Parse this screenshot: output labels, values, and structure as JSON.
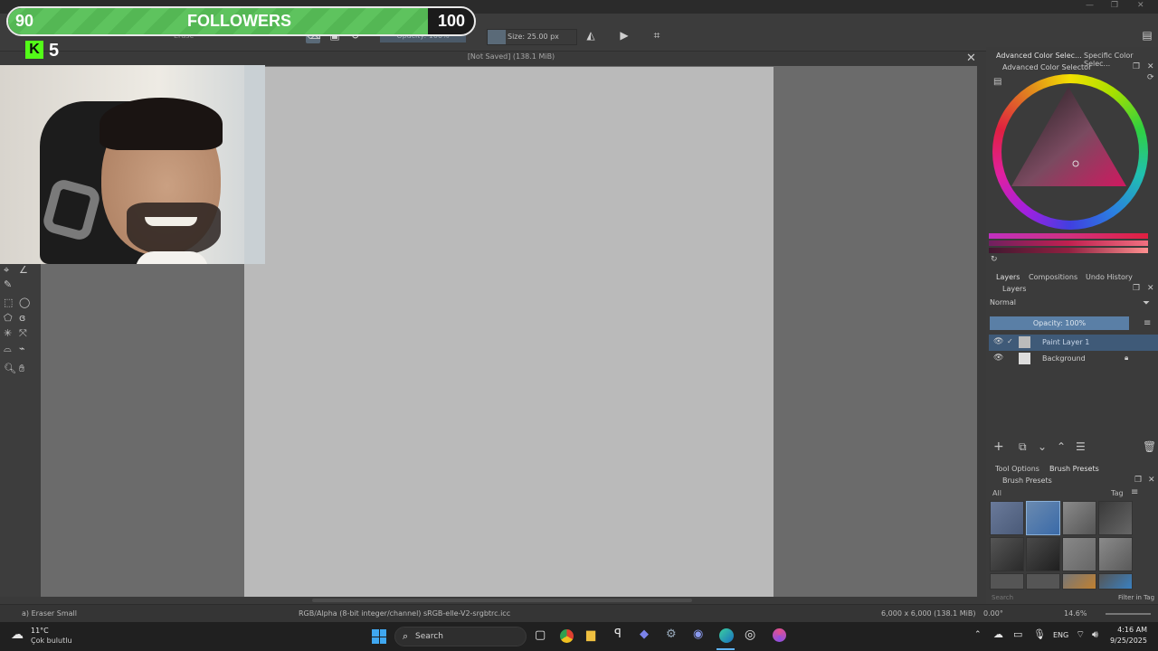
{
  "app": {
    "doc_title": "[Not Saved]  (138.1 MiB)"
  },
  "overlay": {
    "followers_current": "90",
    "followers_label": "FOLLOWERS",
    "followers_goal": "100",
    "followers_progress": 0.9,
    "kick_count": "5",
    "colors": {
      "bar_fill": "#5ec35e",
      "kick_green": "#53fc18"
    }
  },
  "toolbar": {
    "blend_mode": "Erase",
    "opacity_label": "Opacity: 100%",
    "size_label": "Size: 25.00 px"
  },
  "right_panel": {
    "top_tabs": [
      "Advanced Color Selec...",
      "Specific Color Selec..."
    ],
    "color_selector_title": "Advanced Color Selector",
    "layer_tabs": [
      "Layers",
      "Compositions",
      "Undo History"
    ],
    "layers_title": "Layers",
    "blend_mode": "Normal",
    "opacity": "Opacity:  100%",
    "layers": [
      {
        "name": "Paint Layer 1",
        "selected": true
      },
      {
        "name": "Background",
        "selected": false
      }
    ],
    "bottom_tabs": [
      "Tool Options",
      "Brush Presets"
    ],
    "brush_presets_title": "Brush Presets",
    "brush_filter": "All",
    "tag_label": "Tag",
    "search_placeholder": "Search",
    "filter_in_tag": "Filter in Tag",
    "colors": {
      "accent": "#5a7fa6",
      "hue_ring": "conic"
    }
  },
  "statusbar": {
    "brush_name": "a) Eraser Small",
    "color_info": "RGB/Alpha (8-bit integer/channel)  sRGB-elle-V2-srgbtrc.icc",
    "dimensions": "6,000 x 6,000 (138.1 MiB)",
    "rotation": "0.00°",
    "zoom": "14.6%"
  },
  "taskbar": {
    "weather_temp": "11°C",
    "weather_desc": "Çok bulutlu",
    "search_placeholder": "Search",
    "lang": "ENG",
    "time": "4:16 AM",
    "date": "9/25/2025"
  }
}
